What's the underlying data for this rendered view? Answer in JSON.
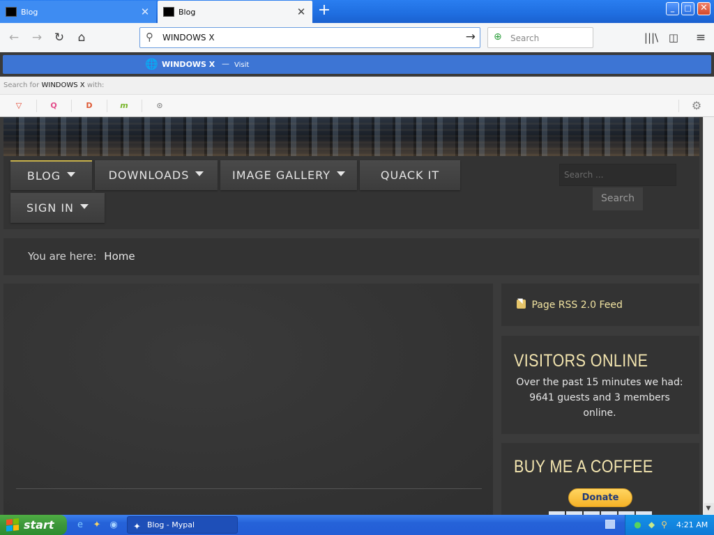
{
  "browser": {
    "tabs": [
      {
        "label": "Blog",
        "close": "✕"
      },
      {
        "label": "Blog",
        "close": "✕"
      }
    ],
    "new_tab": "+",
    "window_buttons": {
      "minimize": "_",
      "maximize": "□",
      "close": "✕"
    },
    "nav": {
      "back": "←",
      "forward": "→",
      "reload": "↻",
      "home": "⌂",
      "library": "|||\\",
      "sidebar": "◫",
      "menu": "≡"
    },
    "url": "WINDOWS X",
    "url_go": "→",
    "search_placeholder": "Search",
    "suggestion": {
      "title": "WINDOWS X",
      "dash": "—",
      "action": "Visit"
    },
    "search_with": {
      "prefix": "Search for",
      "query": "WINDOWS X",
      "suffix": "with:"
    },
    "engines": [
      "▽",
      "Q",
      "D",
      "m",
      "⊙"
    ],
    "engine_settings": "⚙"
  },
  "site": {
    "nav": [
      {
        "label": "BLOG",
        "dropdown": true
      },
      {
        "label": "DOWNLOADS",
        "dropdown": true
      },
      {
        "label": "IMAGE GALLERY",
        "dropdown": true
      },
      {
        "label": "QUACK IT",
        "dropdown": false
      },
      {
        "label": "SIGN IN",
        "dropdown": true
      }
    ],
    "search_placeholder": "Search ...",
    "search_button": "Search",
    "breadcrumb": {
      "prefix": "You are here:",
      "current": "Home"
    },
    "rss_link": "Page RSS 2.0 Feed",
    "visitors": {
      "title": "VISITORS ONLINE",
      "text": "Over the past 15 minutes we had: 9641 guests and 3 members online."
    },
    "coffee": {
      "title": "BUY ME A COFFEE",
      "donate": "Donate"
    }
  },
  "taskbar": {
    "start": "start",
    "window_label": "Blog - Mypal",
    "clock": "4:21 AM"
  },
  "colors": {
    "accent": "#3d75d4",
    "heading_gold": "#f4e6b0",
    "donate_yellow": "#ffc43a"
  }
}
